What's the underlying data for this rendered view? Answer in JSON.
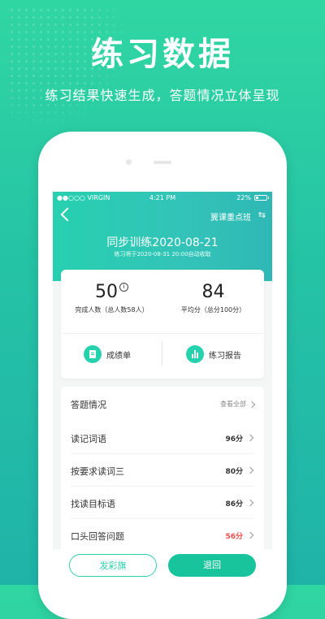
{
  "hero": {
    "title": "练习数据",
    "subtitle": "练习结果快速生成，答题情况立体呈现"
  },
  "status_bar": {
    "carrier": "●●○○○ VIRGIN",
    "time": "4:21 PM",
    "battery_text": "22%"
  },
  "nav": {
    "class_name": "翼课重点班"
  },
  "session": {
    "title": "同步训练2020-08-21",
    "deadline": "练习将于2020-08-31 20:00自动收取"
  },
  "stats": {
    "completed_value": "50",
    "completed_label": "完成人数（总人数58人）",
    "average_value": "84",
    "average_label": "平均分（总分100分）"
  },
  "actions": {
    "transcript": "成绩单",
    "report": "练习报告"
  },
  "answers": {
    "heading": "答题情况",
    "view_all": "查看全部",
    "rows": [
      {
        "name": "读记词语",
        "score": "96分"
      },
      {
        "name": "按要求读词三",
        "score": "80分"
      },
      {
        "name": "找读目标语",
        "score": "86分"
      },
      {
        "name": "口头回答问题",
        "score": "56分"
      }
    ]
  },
  "bottom": {
    "left_button": "发彩旗",
    "right_button": "退回"
  },
  "colors": {
    "brand": "#18c49b",
    "low_score": "#ef4b4b"
  }
}
